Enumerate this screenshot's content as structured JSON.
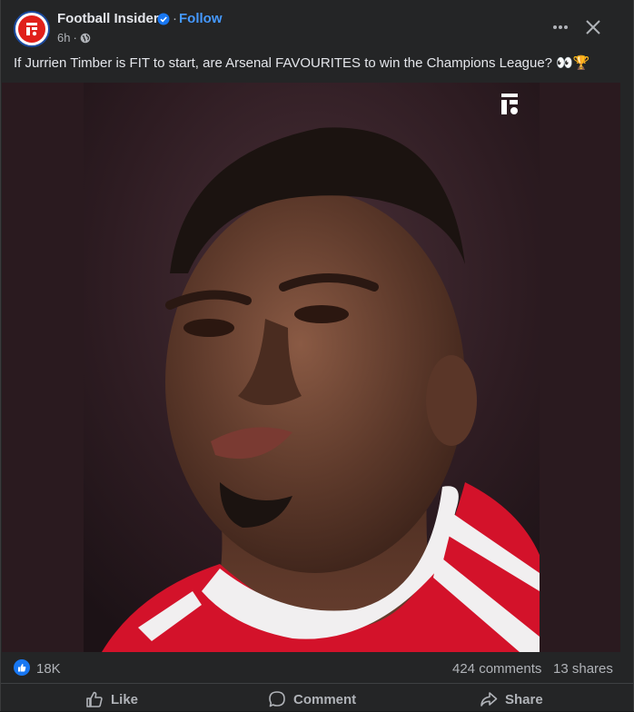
{
  "post": {
    "page_name": "Football Insider",
    "follow_label": "Follow",
    "time": "6h",
    "caption": "If Jurrien Timber is FIT to start, are Arsenal FAVOURITES to win the Champions League? 👀🏆",
    "icons": {
      "avatar": "football-insider-logo",
      "verified": "verified-badge-icon",
      "audience": "globe-icon",
      "more": "more-options-icon",
      "close": "close-icon"
    }
  },
  "stats": {
    "reactions": "18K",
    "comments": "424 comments",
    "shares": "13 shares"
  },
  "actions": {
    "like": "Like",
    "comment": "Comment",
    "share": "Share"
  },
  "colors": {
    "background": "#242526",
    "accent": "#4599ff",
    "like_blue": "#1877f2",
    "brand_red": "#e0201b",
    "jersey_red": "#d3122a"
  }
}
